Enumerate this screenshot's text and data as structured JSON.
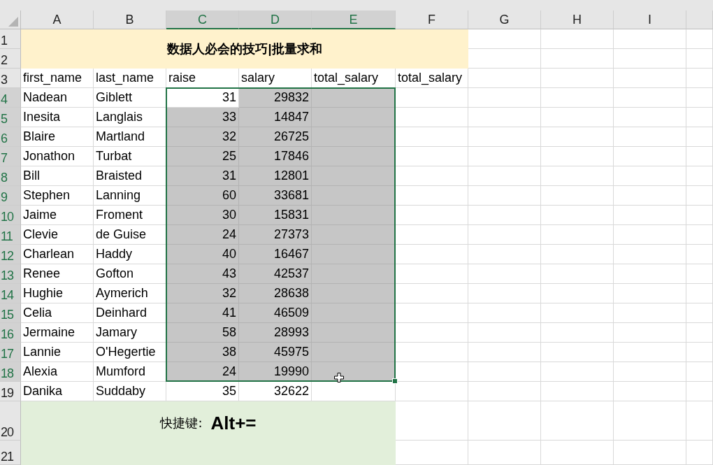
{
  "columns": [
    {
      "label": "A",
      "selected": false
    },
    {
      "label": "B",
      "selected": false
    },
    {
      "label": "C",
      "selected": true
    },
    {
      "label": "D",
      "selected": true
    },
    {
      "label": "E",
      "selected": true
    },
    {
      "label": "F",
      "selected": false
    },
    {
      "label": "G",
      "selected": false
    },
    {
      "label": "H",
      "selected": false
    },
    {
      "label": "I",
      "selected": false
    }
  ],
  "title": "数据人必会的技巧|批量求和",
  "header_row": [
    "first_name",
    "last_name",
    "raise",
    "salary",
    "total_salary",
    "total_salary"
  ],
  "data_rows": [
    {
      "cells": [
        "Nadean",
        "Giblett",
        "31",
        "29832"
      ],
      "selected": true,
      "active": true
    },
    {
      "cells": [
        "Inesita",
        "Langlais",
        "33",
        "14847"
      ],
      "selected": true,
      "active": false
    },
    {
      "cells": [
        "Blaire",
        "Martland",
        "32",
        "26725"
      ],
      "selected": true,
      "active": false
    },
    {
      "cells": [
        "Jonathon",
        "Turbat",
        "25",
        "17846"
      ],
      "selected": true,
      "active": false
    },
    {
      "cells": [
        "Bill",
        "Braisted",
        "31",
        "12801"
      ],
      "selected": true,
      "active": false
    },
    {
      "cells": [
        "Stephen",
        "Lanning",
        "60",
        "33681"
      ],
      "selected": true,
      "active": false
    },
    {
      "cells": [
        "Jaime",
        "Froment",
        "30",
        "15831"
      ],
      "selected": true,
      "active": false
    },
    {
      "cells": [
        "Clevie",
        "de Guise",
        "24",
        "27373"
      ],
      "selected": true,
      "active": false
    },
    {
      "cells": [
        "Charlean",
        "Haddy",
        "40",
        "16467"
      ],
      "selected": true,
      "active": false
    },
    {
      "cells": [
        "Renee",
        "Gofton",
        "43",
        "42537"
      ],
      "selected": true,
      "active": false
    },
    {
      "cells": [
        "Hughie",
        "Aymerich",
        "32",
        "28638"
      ],
      "selected": true,
      "active": false
    },
    {
      "cells": [
        "Celia",
        "Deinhard",
        "41",
        "46509"
      ],
      "selected": true,
      "active": false
    },
    {
      "cells": [
        "Jermaine",
        "Jamary",
        "58",
        "28993"
      ],
      "selected": true,
      "active": false
    },
    {
      "cells": [
        "Lannie",
        "O'Hegertie",
        "38",
        "45975"
      ],
      "selected": true,
      "active": false
    },
    {
      "cells": [
        "Alexia",
        "Mumford",
        "24",
        "19990"
      ],
      "selected": true,
      "active": false
    },
    {
      "cells": [
        "Danika",
        "Suddaby",
        "35",
        "32622"
      ],
      "selected": false,
      "active": false
    }
  ],
  "note": {
    "label": "快捷键:",
    "shortcut": "Alt+="
  },
  "row_numbers": [
    "1",
    "2",
    "3",
    "4",
    "5",
    "6",
    "7",
    "8",
    "9",
    "10",
    "11",
    "12",
    "13",
    "14",
    "15",
    "16",
    "17",
    "18",
    "19",
    "20",
    "21"
  ]
}
